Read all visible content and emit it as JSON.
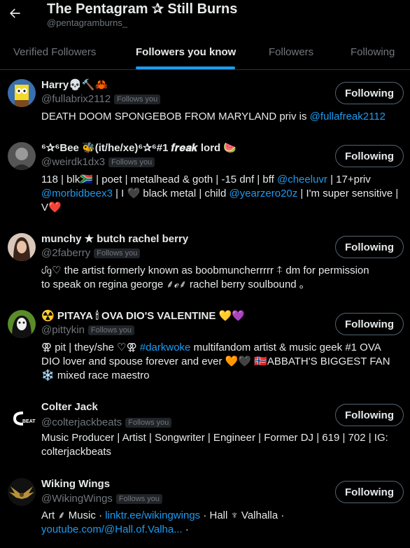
{
  "header": {
    "title": "The Pentagram ✰ Still Burns",
    "handle": "@pentagramburns_"
  },
  "tabs": [
    {
      "label": "Verified Followers"
    },
    {
      "label": "Followers you know"
    },
    {
      "label": "Followers"
    },
    {
      "label": "Following"
    }
  ],
  "follows_you_label": "Follows you",
  "following_label": "Following",
  "users": [
    {
      "name": "Harry💀🔨🦀",
      "handle": "@fullabrix2112",
      "bio_lines": [
        [
          {
            "t": "DEATH DOOM SPONGEBOB FROM MARYLAND priv is "
          },
          {
            "t": "@fullafreak2112",
            "link": true
          }
        ]
      ]
    },
    {
      "name": "⁶✰⁶Bee 🐝(it/he/xe)⁶✰⁶#1 𝒇𝒓𝒆𝒂𝒌 lord 🍉",
      "handle": "@weirdk1dx3",
      "bio_lines": [
        [
          {
            "t": "118 | blk🇿🇦 | poet | metalhead & goth | -15 dnf | bff "
          },
          {
            "t": "@cheeluvr",
            "link": true
          },
          {
            "t": " | 17+priv"
          }
        ],
        [
          {
            "t": "@morbidbeex3",
            "link": true
          },
          {
            "t": " | I 🖤 black metal | child "
          },
          {
            "t": "@yearzero20z",
            "link": true
          },
          {
            "t": " | I'm super sensitive |"
          }
        ],
        [
          {
            "t": "V❤️"
          }
        ]
      ]
    },
    {
      "name": "munchy ★ butch rachel berry",
      "handle": "@2faberry",
      "bio_lines": [
        [
          {
            "t": "ᦔᧁ♡ the artist formerly known as boobmuncherrrrr    ⍏ dm for permission"
          }
        ],
        [
          {
            "t": "to speak on regina george           ⸙ℯ⸙ rachel berry soulbound ｡"
          }
        ]
      ]
    },
    {
      "name": "☢️ PITAYA 🕯 OVA DIO'S VALENTINE 💛💜",
      "handle": "@pittykin",
      "bio_lines": [
        [
          {
            "t": "⚢ pit | they/she ♡⚢ "
          },
          {
            "t": "#darkwoke",
            "link": true
          },
          {
            "t": " multifandom artist & music geek #1 OVA"
          }
        ],
        [
          {
            "t": "DIO lover and spouse forever and ever 🧡🖤 🇳🇴ABBATH'S BIGGEST FAN"
          }
        ],
        [
          {
            "t": "❄️ mixed race maestro"
          }
        ]
      ]
    },
    {
      "name": "Colter Jack",
      "handle": "@colterjackbeats",
      "bio_lines": [
        [
          {
            "t": "Music Producer | Artist | Songwriter | Engineer | Former DJ | 619 | 702 | IG:"
          }
        ],
        [
          {
            "t": "colterjackbeats"
          }
        ]
      ]
    },
    {
      "name": "Wiking Wings",
      "handle": "@WikingWings",
      "bio_lines": [
        [
          {
            "t": "Art ⸙ Music · "
          },
          {
            "t": "linktr.ee/wikingwings",
            "link": true
          },
          {
            "t": " · Hall ♆ Valhalla ·"
          }
        ],
        [
          {
            "t": "youtube.com/@Hall.of.Valha...",
            "link": true
          },
          {
            "t": " ·"
          }
        ]
      ]
    }
  ]
}
